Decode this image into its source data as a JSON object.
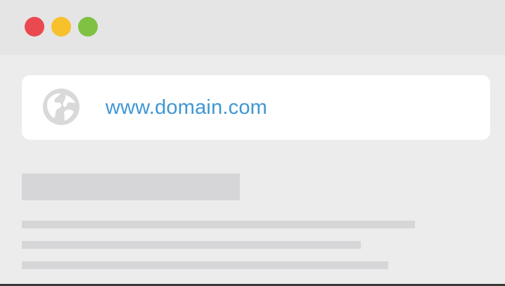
{
  "window": {
    "traffic_lights": [
      {
        "name": "close",
        "color": "#ea4a4f"
      },
      {
        "name": "minimize",
        "color": "#f7c12b"
      },
      {
        "name": "zoom",
        "color": "#7fc142"
      }
    ]
  },
  "address_bar": {
    "icon": "globe-icon",
    "url": "www.domain.com",
    "url_color": "#3f97d3"
  },
  "content": {
    "placeholder_color": "#d6d6d9"
  }
}
